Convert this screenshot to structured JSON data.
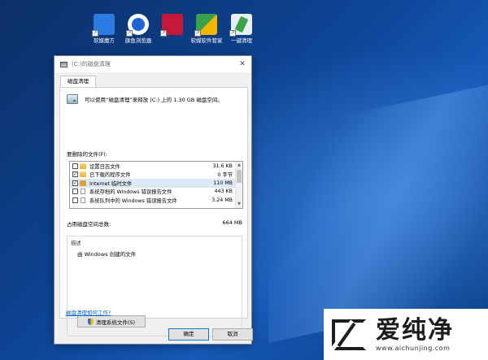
{
  "desktop": {
    "icons": [
      {
        "label": "软媒魔方",
        "color": "#2a7be4"
      },
      {
        "label": "旗鱼浏览器",
        "color": "#1e64d6"
      },
      {
        "label": "",
        "color": "#c8183a"
      },
      {
        "label": "软媒软件管家",
        "color": "#3aa24a"
      },
      {
        "label": "一键清理",
        "color": "#e9eef4"
      }
    ]
  },
  "dialog": {
    "title": "(C:)的磁盘清理",
    "close_glyph": "✕",
    "tab": "磁盘清理",
    "intro": "可以使用“磁盘清理”来释放 (C:) 上的 1.30 GB 磁盘空间。",
    "files_label": "要删除的文件(F):",
    "files": [
      {
        "name": "设置日志文件",
        "size": "31.6 KB",
        "checked": false,
        "icon": "folder"
      },
      {
        "name": "已下载的程序文件",
        "size": "0 字节",
        "checked": true,
        "icon": "folder"
      },
      {
        "name": "Internet 临时文件",
        "size": "110 MB",
        "checked": true,
        "icon": "lock"
      },
      {
        "name": "系统存档的 Windows 错误报告文件",
        "size": "443 KB",
        "checked": false,
        "icon": "doc"
      },
      {
        "name": "系统队列中的 Windows 错误报告文件",
        "size": "3.24 MB",
        "checked": false,
        "icon": "doc"
      }
    ],
    "total_label": "占用磁盘空间总数:",
    "total_value": "664 MB",
    "description_title": "描述",
    "description_text": "由 Windows 创建的文件",
    "cleanup_system_button": "清理系统文件(S)",
    "help_link": "磁盘清理如何工作?",
    "ok_button": "确定",
    "cancel_button": "取消",
    "check_glyph": "✓"
  },
  "watermark": {
    "brand": "爱纯净",
    "url": "www.aichunjing.com"
  }
}
